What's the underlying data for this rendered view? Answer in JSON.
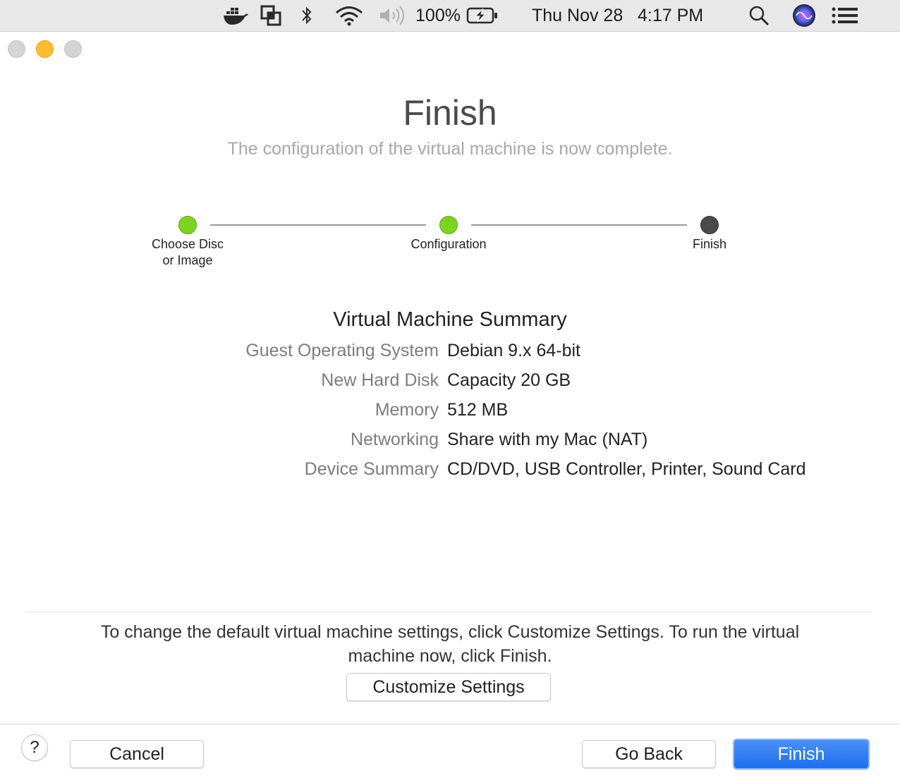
{
  "menubar": {
    "icons": [
      "docker-icon",
      "vmware-icon",
      "bluetooth-icon",
      "wifi-icon",
      "volume-icon"
    ],
    "battery_percent": "100%",
    "date": "Thu Nov 28",
    "time": "4:17 PM"
  },
  "wizard": {
    "title": "Finish",
    "subtitle": "The configuration of the virtual machine is now complete.",
    "steps": [
      {
        "label": "Choose Disc\nor Image",
        "line1": "Choose Disc",
        "line2": "or Image",
        "state": "done"
      },
      {
        "label": "Configuration",
        "state": "done"
      },
      {
        "label": "Finish",
        "state": "current"
      }
    ],
    "colors": {
      "done": "#7ed321",
      "current": "#4a4a4a",
      "accent": "#2f7df5"
    }
  },
  "summary": {
    "title": "Virtual Machine Summary",
    "rows": [
      {
        "key": "Guest Operating System",
        "value": "Debian 9.x 64-bit"
      },
      {
        "key": "New Hard Disk",
        "value": "Capacity 20 GB"
      },
      {
        "key": "Memory",
        "value": "512 MB"
      },
      {
        "key": "Networking",
        "value": "Share with my Mac (NAT)"
      },
      {
        "key": "Device Summary",
        "value": "CD/DVD, USB Controller, Printer, Sound Card"
      }
    ]
  },
  "info": {
    "text": "To change the default virtual machine settings, click Customize Settings. To run the virtual machine now, click Finish."
  },
  "buttons": {
    "customize": "Customize Settings",
    "help": "?",
    "cancel": "Cancel",
    "go_back": "Go Back",
    "finish": "Finish"
  }
}
